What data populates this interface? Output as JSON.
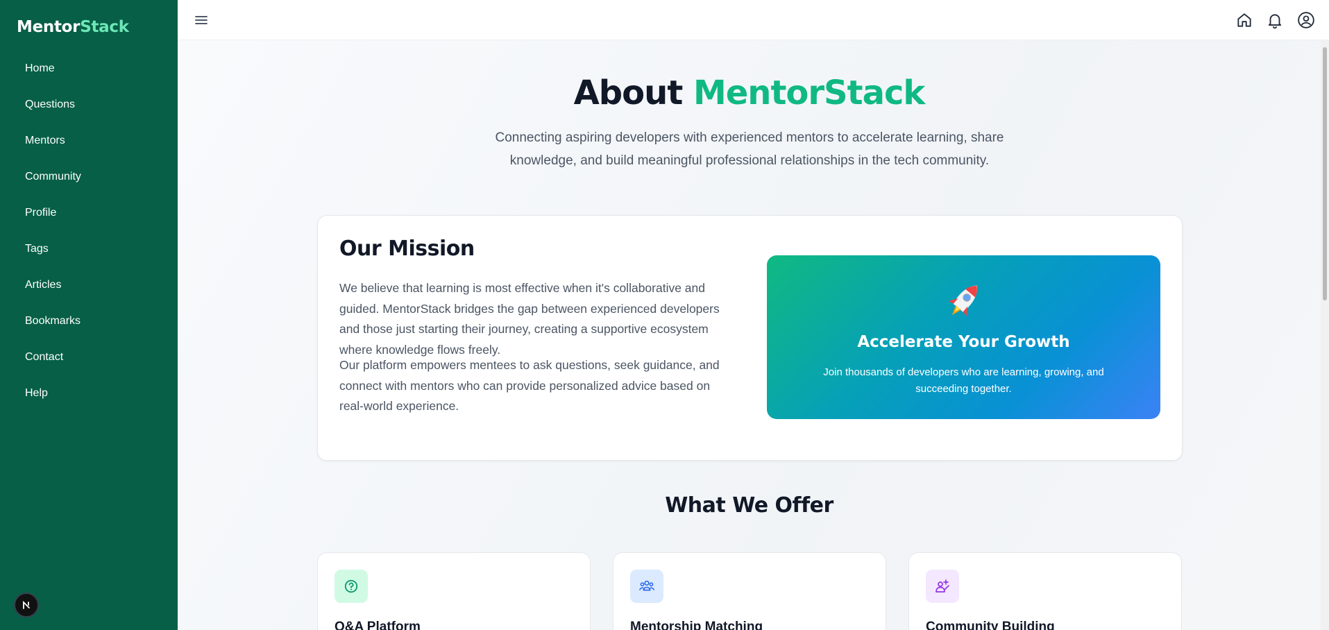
{
  "sidebar": {
    "brand_part1": "Mentor",
    "brand_part2": "Stack",
    "items": [
      {
        "label": "Home"
      },
      {
        "label": "Questions"
      },
      {
        "label": "Mentors"
      },
      {
        "label": "Community"
      },
      {
        "label": "Profile"
      },
      {
        "label": "Tags"
      },
      {
        "label": "Articles"
      },
      {
        "label": "Bookmarks"
      },
      {
        "label": "Contact"
      },
      {
        "label": "Help"
      }
    ]
  },
  "topbar": {
    "menu_icon": "hamburger-menu-icon",
    "icons": [
      "home-icon",
      "bell-icon",
      "user-circle-icon"
    ]
  },
  "hero": {
    "title_part1": "About ",
    "title_accent": "MentorStack",
    "subtitle": "Connecting aspiring developers with experienced mentors to accelerate learning, share knowledge, and build meaningful professional relationships in the tech community."
  },
  "mission": {
    "title": "Our Mission",
    "paragraph1": "We believe that learning is most effective when it's collaborative and guided. MentorStack bridges the gap between experienced developers and those just starting their journey, creating a supportive ecosystem where knowledge flows freely.",
    "paragraph2": "Our platform empowers mentees to ask questions, seek guidance, and connect with mentors who can provide personalized advice based on real-world experience.",
    "highlight": {
      "icon": "rocket-icon",
      "title": "Accelerate Your Growth",
      "subtitle": "Join thousands of developers who are learning, growing, and succeeding together."
    }
  },
  "offer": {
    "title": "What We Offer",
    "features": [
      {
        "title": "Q&A Platform",
        "icon": "question-circle-icon",
        "icon_bg": "#d1fae5",
        "icon_color": "#059669"
      },
      {
        "title": "Mentorship Matching",
        "icon": "users-group-icon",
        "icon_bg": "#dbeafe",
        "icon_color": "#2563eb"
      },
      {
        "title": "Community Building",
        "icon": "sparkle-person-icon",
        "icon_bg": "#f3e8ff",
        "icon_color": "#9333ea"
      }
    ]
  },
  "colors": {
    "sidebar_bg": "#065f46",
    "accent": "#10b981",
    "brand_accent": "#6ee7b7"
  }
}
